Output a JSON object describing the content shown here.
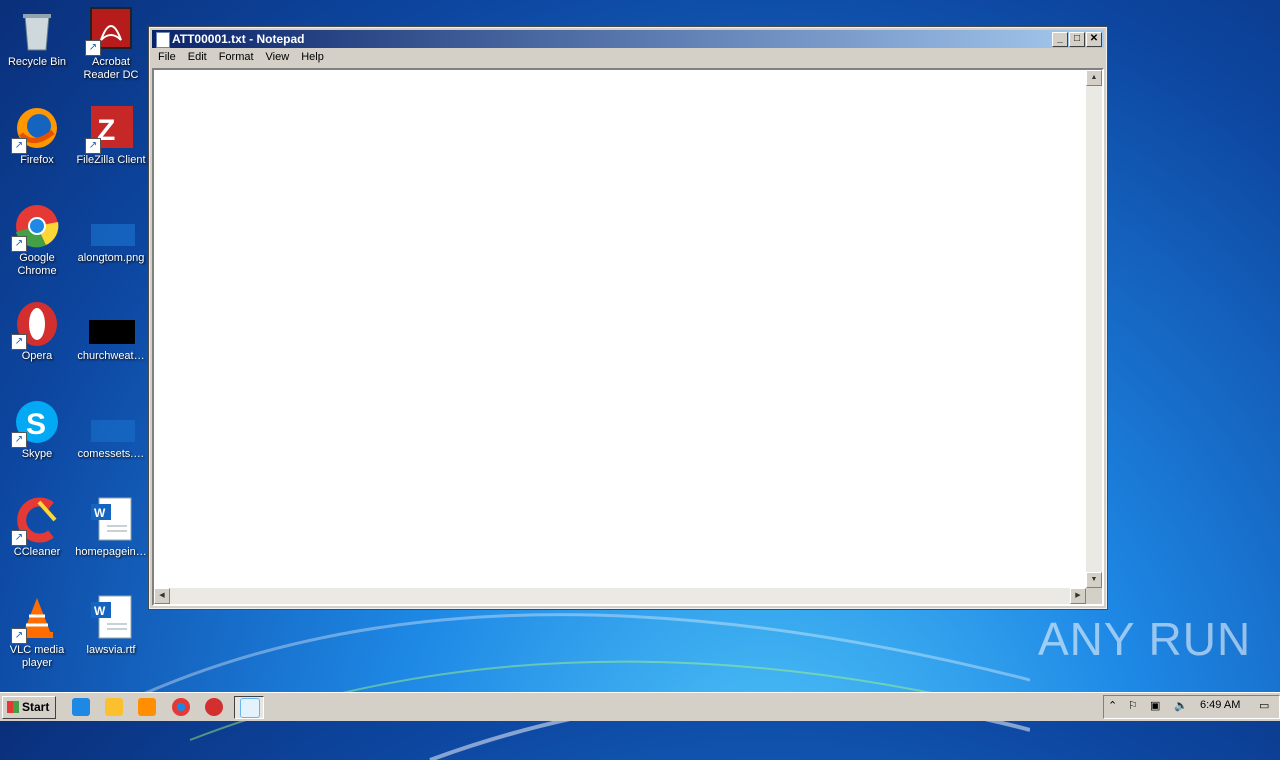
{
  "desktop": {
    "icons": [
      {
        "label": "Recycle Bin",
        "icon": "recycle-bin-icon"
      },
      {
        "label": "Acrobat Reader DC",
        "icon": "acrobat-reader-icon"
      },
      {
        "label": "Firefox",
        "icon": "firefox-icon"
      },
      {
        "label": "FileZilla Client",
        "icon": "filezilla-icon"
      },
      {
        "label": "Google Chrome",
        "icon": "chrome-icon"
      },
      {
        "label": "alongtom.png",
        "icon": "png-file-icon"
      },
      {
        "label": "Opera",
        "icon": "opera-icon"
      },
      {
        "label": "churchweat…",
        "icon": "image-file-icon"
      },
      {
        "label": "Skype",
        "icon": "skype-icon"
      },
      {
        "label": "comessets.…",
        "icon": "file-icon"
      },
      {
        "label": "CCleaner",
        "icon": "ccleaner-icon"
      },
      {
        "label": "homepagein…",
        "icon": "word-document-icon"
      },
      {
        "label": "VLC media player",
        "icon": "vlc-icon"
      },
      {
        "label": "lawsvia.rtf",
        "icon": "word-document-icon"
      }
    ]
  },
  "window": {
    "title": "ATT00001.txt - Notepad",
    "menu": [
      "File",
      "Edit",
      "Format",
      "View",
      "Help"
    ],
    "content": ""
  },
  "watermark": "ANY RUN",
  "taskbar": {
    "start_label": "Start",
    "clock": "6:49 AM"
  },
  "colors": {
    "titlebar_start": "#0a246a",
    "titlebar_end": "#a6caf0",
    "desktop": "#1e88e5"
  }
}
